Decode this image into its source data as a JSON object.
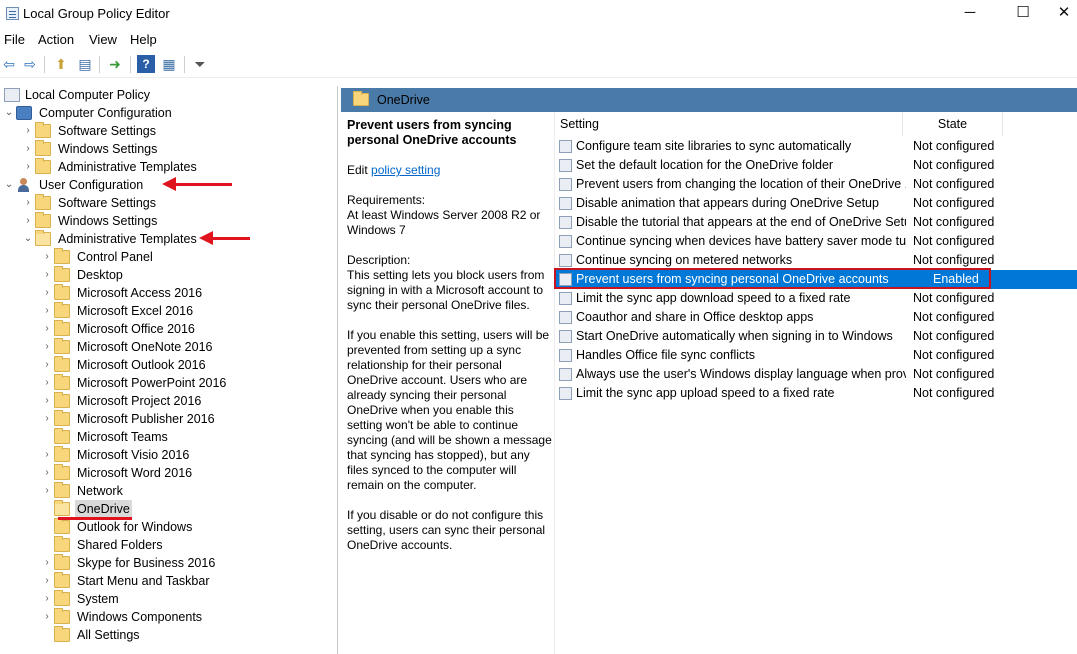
{
  "window": {
    "title": "Local Group Policy Editor",
    "min": "─",
    "max": "☐",
    "close": "✕"
  },
  "menu": [
    "File",
    "Action",
    "View",
    "Help"
  ],
  "toolbar": {
    "icons": [
      "back-icon",
      "forward-icon",
      "up-folder-icon",
      "show-hide-tree-icon",
      "export-list-icon",
      "help-icon",
      "properties-icon",
      "filter-icon"
    ],
    "glyphs": [
      "⇦",
      "⇨",
      "⬆",
      "▤",
      "➜",
      "?",
      "▦",
      "⏷"
    ]
  },
  "tree": [
    {
      "label": "Local Computer Policy",
      "icon": "policy-icon",
      "level": 0,
      "chevron": ""
    },
    {
      "label": "Computer Configuration",
      "icon": "computer-icon",
      "level": 1,
      "chevron": "⌄"
    },
    {
      "label": "Software Settings",
      "icon": "folder-icon",
      "level": 2,
      "chevron": "›"
    },
    {
      "label": "Windows Settings",
      "icon": "folder-icon",
      "level": 2,
      "chevron": "›"
    },
    {
      "label": "Administrative Templates",
      "icon": "folder-icon",
      "level": 2,
      "chevron": "›"
    },
    {
      "label": "User Configuration",
      "icon": "user-icon",
      "level": 1,
      "chevron": "⌄"
    },
    {
      "label": "Software Settings",
      "icon": "folder-icon",
      "level": 2,
      "chevron": "›"
    },
    {
      "label": "Windows Settings",
      "icon": "folder-icon",
      "level": 2,
      "chevron": "›"
    },
    {
      "label": "Administrative Templates",
      "icon": "folder-open-icon",
      "level": 2,
      "chevron": "⌄"
    },
    {
      "label": "Control Panel",
      "icon": "folder-icon",
      "level": 3,
      "chevron": "›"
    },
    {
      "label": "Desktop",
      "icon": "folder-icon",
      "level": 3,
      "chevron": "›"
    },
    {
      "label": "Microsoft Access 2016",
      "icon": "folder-icon",
      "level": 3,
      "chevron": "›"
    },
    {
      "label": "Microsoft Excel 2016",
      "icon": "folder-icon",
      "level": 3,
      "chevron": "›"
    },
    {
      "label": "Microsoft Office 2016",
      "icon": "folder-icon",
      "level": 3,
      "chevron": "›"
    },
    {
      "label": "Microsoft OneNote 2016",
      "icon": "folder-icon",
      "level": 3,
      "chevron": "›"
    },
    {
      "label": "Microsoft Outlook 2016",
      "icon": "folder-icon",
      "level": 3,
      "chevron": "›"
    },
    {
      "label": "Microsoft PowerPoint 2016",
      "icon": "folder-icon",
      "level": 3,
      "chevron": "›"
    },
    {
      "label": "Microsoft Project 2016",
      "icon": "folder-icon",
      "level": 3,
      "chevron": "›"
    },
    {
      "label": "Microsoft Publisher 2016",
      "icon": "folder-icon",
      "level": 3,
      "chevron": "›"
    },
    {
      "label": "Microsoft Teams",
      "icon": "folder-icon",
      "level": 3,
      "chevron": ""
    },
    {
      "label": "Microsoft Visio 2016",
      "icon": "folder-icon",
      "level": 3,
      "chevron": "›"
    },
    {
      "label": "Microsoft Word 2016",
      "icon": "folder-icon",
      "level": 3,
      "chevron": "›"
    },
    {
      "label": "Network",
      "icon": "folder-icon",
      "level": 3,
      "chevron": "›"
    },
    {
      "label": "OneDrive",
      "icon": "folder-open-icon",
      "level": 3,
      "chevron": "",
      "selected": true
    },
    {
      "label": "Outlook for Windows",
      "icon": "folder-icon",
      "level": 3,
      "chevron": ""
    },
    {
      "label": "Shared Folders",
      "icon": "folder-icon",
      "level": 3,
      "chevron": ""
    },
    {
      "label": "Skype for Business 2016",
      "icon": "folder-icon",
      "level": 3,
      "chevron": "›"
    },
    {
      "label": "Start Menu and Taskbar",
      "icon": "folder-icon",
      "level": 3,
      "chevron": "›"
    },
    {
      "label": "System",
      "icon": "folder-icon",
      "level": 3,
      "chevron": "›"
    },
    {
      "label": "Windows Components",
      "icon": "folder-icon",
      "level": 3,
      "chevron": "›"
    },
    {
      "label": "All Settings",
      "icon": "folder-icon",
      "level": 3,
      "chevron": ""
    }
  ],
  "right_header": {
    "title": "OneDrive"
  },
  "description": {
    "title": "Prevent users from syncing personal OneDrive accounts",
    "edit_prefix": "Edit ",
    "edit_link": "policy setting ",
    "requirements_label": "Requirements:",
    "requirements": "At least Windows Server 2008 R2 or Windows 7",
    "description_label": "Description:",
    "p1": "This setting lets you block users from signing in with a Microsoft account to sync their personal OneDrive files.",
    "p2": "If you enable this setting, users will be prevented from setting up a sync relationship for their personal OneDrive account. Users who are already syncing their personal OneDrive when you enable this setting won't be able to continue syncing (and will be shown a message that syncing has stopped), but any files synced to the computer will remain on the computer.",
    "p3": "If you disable or do not configure this setting, users can sync their personal OneDrive accounts."
  },
  "table": {
    "col_setting": "Setting",
    "col_state": "State",
    "rows": [
      {
        "setting": "Configure team site libraries to sync automatically",
        "state": "Not configured"
      },
      {
        "setting": "Set the default location for the OneDrive folder",
        "state": "Not configured"
      },
      {
        "setting": "Prevent users from changing the location of their OneDrive ...",
        "state": "Not configured"
      },
      {
        "setting": "Disable animation that appears during OneDrive Setup",
        "state": "Not configured"
      },
      {
        "setting": "Disable the tutorial that appears at the end of OneDrive Setup",
        "state": "Not configured"
      },
      {
        "setting": "Continue syncing when devices have battery saver mode tur...",
        "state": "Not configured"
      },
      {
        "setting": "Continue syncing on metered networks",
        "state": "Not configured"
      },
      {
        "setting": "Prevent users from syncing personal OneDrive accounts",
        "state": "Enabled",
        "selected": true
      },
      {
        "setting": "Limit the sync app download speed to a fixed rate",
        "state": "Not configured"
      },
      {
        "setting": "Coauthor and share in Office desktop apps",
        "state": "Not configured"
      },
      {
        "setting": "Start OneDrive automatically when signing in to Windows",
        "state": "Not configured"
      },
      {
        "setting": "Handles Office file sync conflicts",
        "state": "Not configured"
      },
      {
        "setting": "Always use the user's Windows display language when provi...",
        "state": "Not configured"
      },
      {
        "setting": "Limit the sync app upload speed to a fixed rate",
        "state": "Not configured"
      }
    ]
  },
  "colors": {
    "selection": "#0078d7",
    "annotation": "#e0141e",
    "header_bar": "#4a7aa7"
  }
}
